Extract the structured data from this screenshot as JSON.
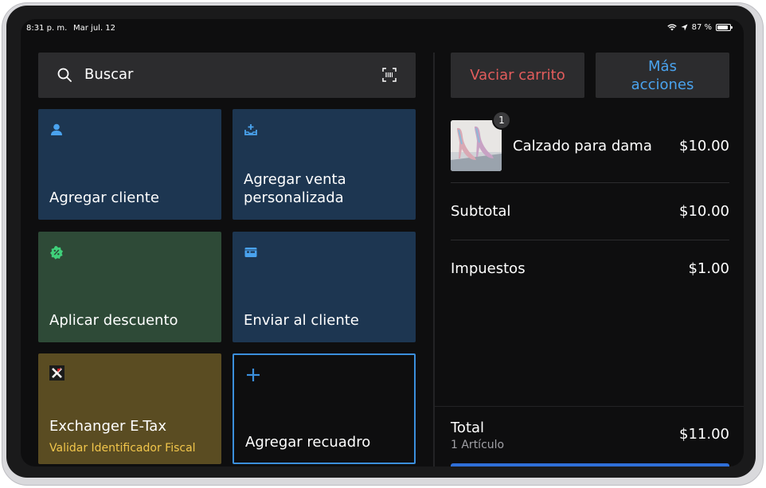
{
  "status": {
    "time": "8:31 p. m.",
    "date": "Mar jul. 12",
    "battery": "87 %",
    "battery_level": 0.87
  },
  "search": {
    "placeholder": "Buscar"
  },
  "tiles": {
    "add_customer": "Agregar cliente",
    "custom_sale": "Agregar venta personalizada",
    "apply_discount": "Aplicar descuento",
    "send_customer": "Enviar al cliente",
    "exchanger_title": "Exchanger E-Tax",
    "exchanger_subtitle": "Validar Identificador Fiscal",
    "add_tile": "Agregar recuadro"
  },
  "cart": {
    "clear_label": "Vaciar carrito",
    "more_label": "Más acciones",
    "item": {
      "name": "Calzado para dama",
      "price": "$10.00",
      "qty": "1"
    },
    "subtotal_label": "Subtotal",
    "subtotal_value": "$10.00",
    "tax_label": "Impuestos",
    "tax_value": "$1.00",
    "total_label": "Total",
    "total_items": "1 Artículo",
    "total_value": "$11.00"
  },
  "colors": {
    "tile_blue": "#1d3651",
    "tile_green": "#2e4a37",
    "tile_yellow": "#5a4c22",
    "accent_blue": "#3b8fdc",
    "danger_red": "#e25c5c"
  }
}
